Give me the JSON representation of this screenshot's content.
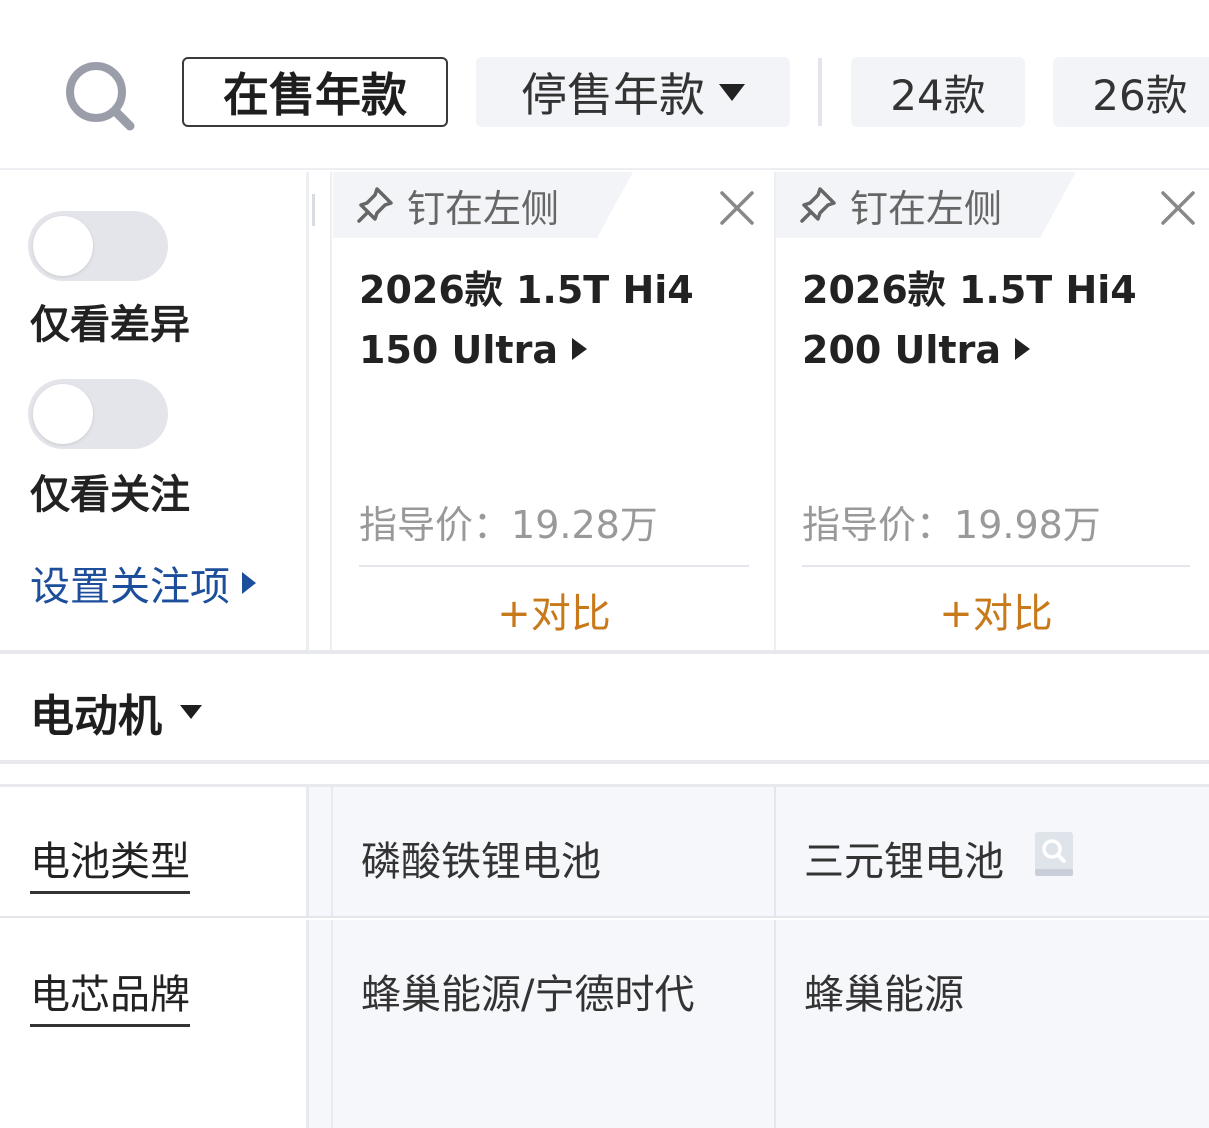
{
  "filter_bar": {
    "on_sale_label": "在售年款",
    "stopped_label": "停售年款",
    "years": [
      "24款",
      "26款"
    ]
  },
  "options": {
    "diff_only_label": "仅看差异",
    "diff_only_enabled": false,
    "follow_only_label": "仅看关注",
    "follow_only_enabled": false,
    "settings_link_label": "设置关注项"
  },
  "cars": [
    {
      "pin_label": "钉在左侧",
      "name_line1": "2026款 1.5T Hi4",
      "name_line2": "150 Ultra",
      "price_label": "指导价：",
      "price_value": "19.28万",
      "compare_label": "+对比"
    },
    {
      "pin_label": "钉在左侧",
      "name_line1": "2026款 1.5T Hi4",
      "name_line2": "200 Ultra",
      "price_label": "指导价：",
      "price_value": "19.98万",
      "compare_label": "+对比"
    }
  ],
  "section": {
    "title": "电动机"
  },
  "specs": [
    {
      "label": "电池类型",
      "values": [
        "磷酸铁锂电池",
        "三元锂电池"
      ]
    },
    {
      "label": "电芯品牌",
      "values": [
        "蜂巢能源/宁德时代",
        "蜂巢能源"
      ]
    }
  ],
  "icons": {
    "search": "search-icon",
    "pin": "pin-icon",
    "close": "close-icon",
    "lookup": "lookup-icon"
  },
  "colors": {
    "link_blue": "#1c4e9c",
    "compare_orange": "#c87a1a",
    "muted_gray": "#999999"
  }
}
